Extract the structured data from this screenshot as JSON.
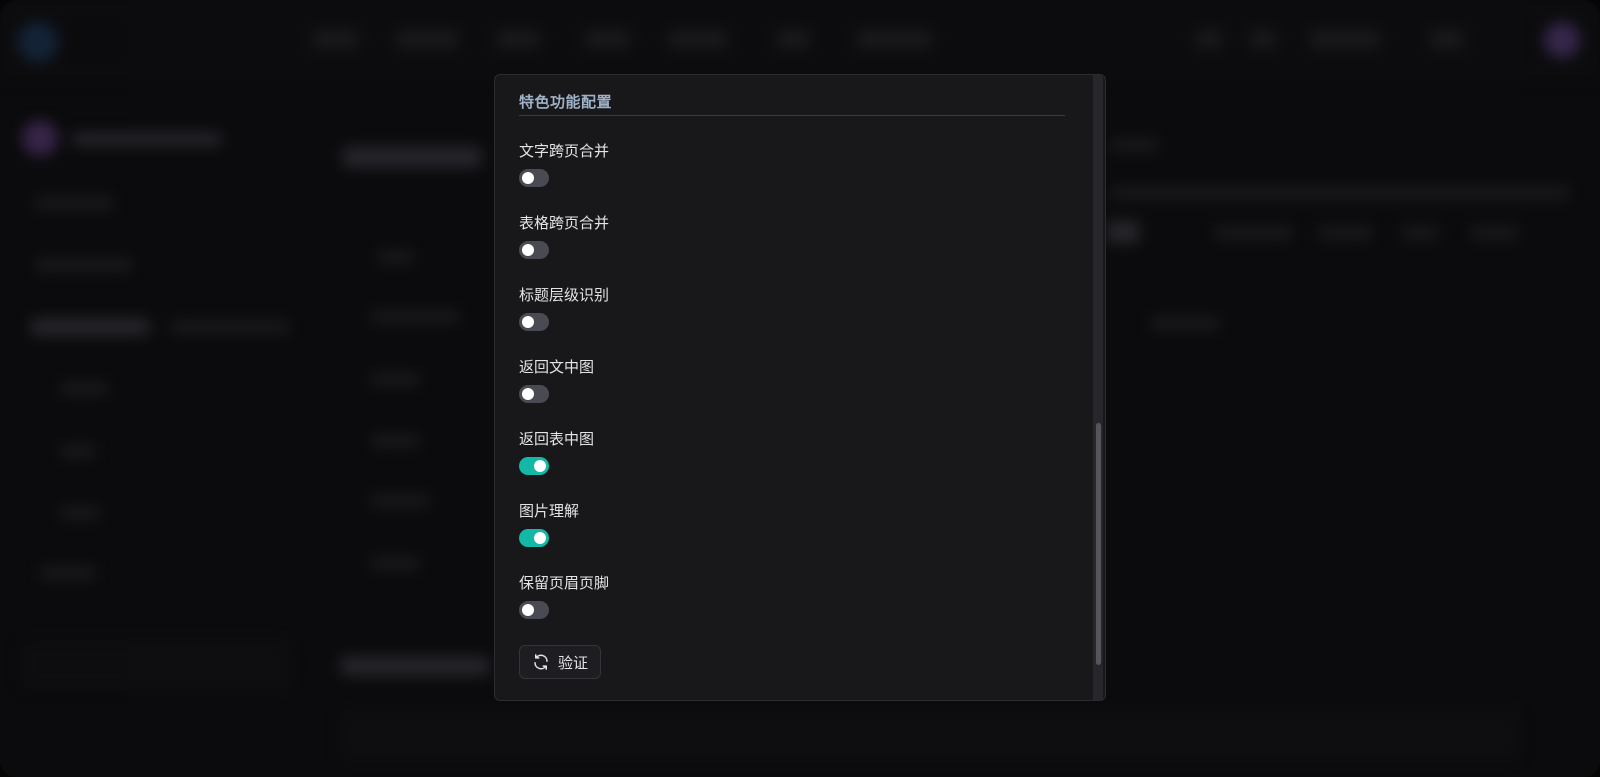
{
  "modal": {
    "section_title": "特色功能配置",
    "options": [
      {
        "label": "文字跨页合并",
        "enabled": false
      },
      {
        "label": "表格跨页合并",
        "enabled": false
      },
      {
        "label": "标题层级识别",
        "enabled": false
      },
      {
        "label": "返回文中图",
        "enabled": false
      },
      {
        "label": "返回表中图",
        "enabled": true
      },
      {
        "label": "图片理解",
        "enabled": true
      },
      {
        "label": "保留页眉页脚",
        "enabled": false
      }
    ],
    "verify_button": {
      "label": "验证",
      "icon": "refresh-icon"
    }
  },
  "colors": {
    "toggle_on": "#14b8a6",
    "toggle_off": "#4a4a52",
    "modal_bg": "#18181b",
    "section_title": "#9fb1c6"
  }
}
